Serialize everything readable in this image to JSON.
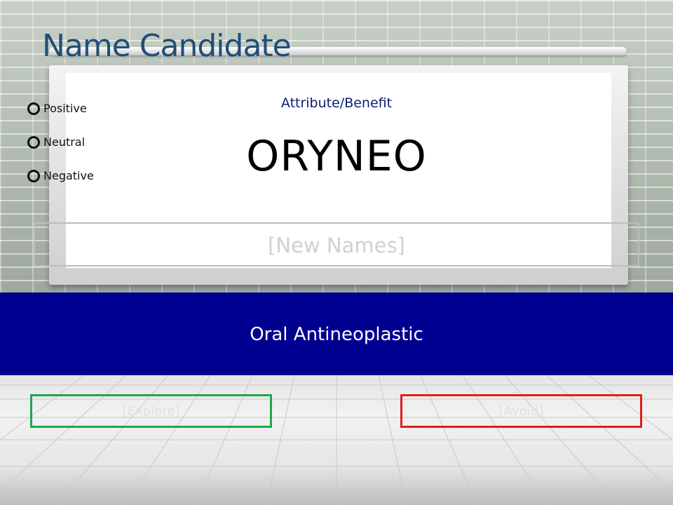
{
  "slide": {
    "title": "Name Candidate",
    "options": [
      {
        "label": "Positive"
      },
      {
        "label": "Neutral"
      },
      {
        "label": "Negative"
      }
    ],
    "attribute_label": "Attribute/Benefit",
    "candidate_name": "ORYNEO",
    "new_names_placeholder": "[New Names]",
    "category_label": "Oral Antineoplastic",
    "explore_placeholder": "[Explore]",
    "avoid_placeholder": "[Avoid]"
  },
  "colors": {
    "title": "#1f4e79",
    "band": "#000090",
    "explore_border": "#1ea84a",
    "avoid_border": "#e01d1d"
  }
}
